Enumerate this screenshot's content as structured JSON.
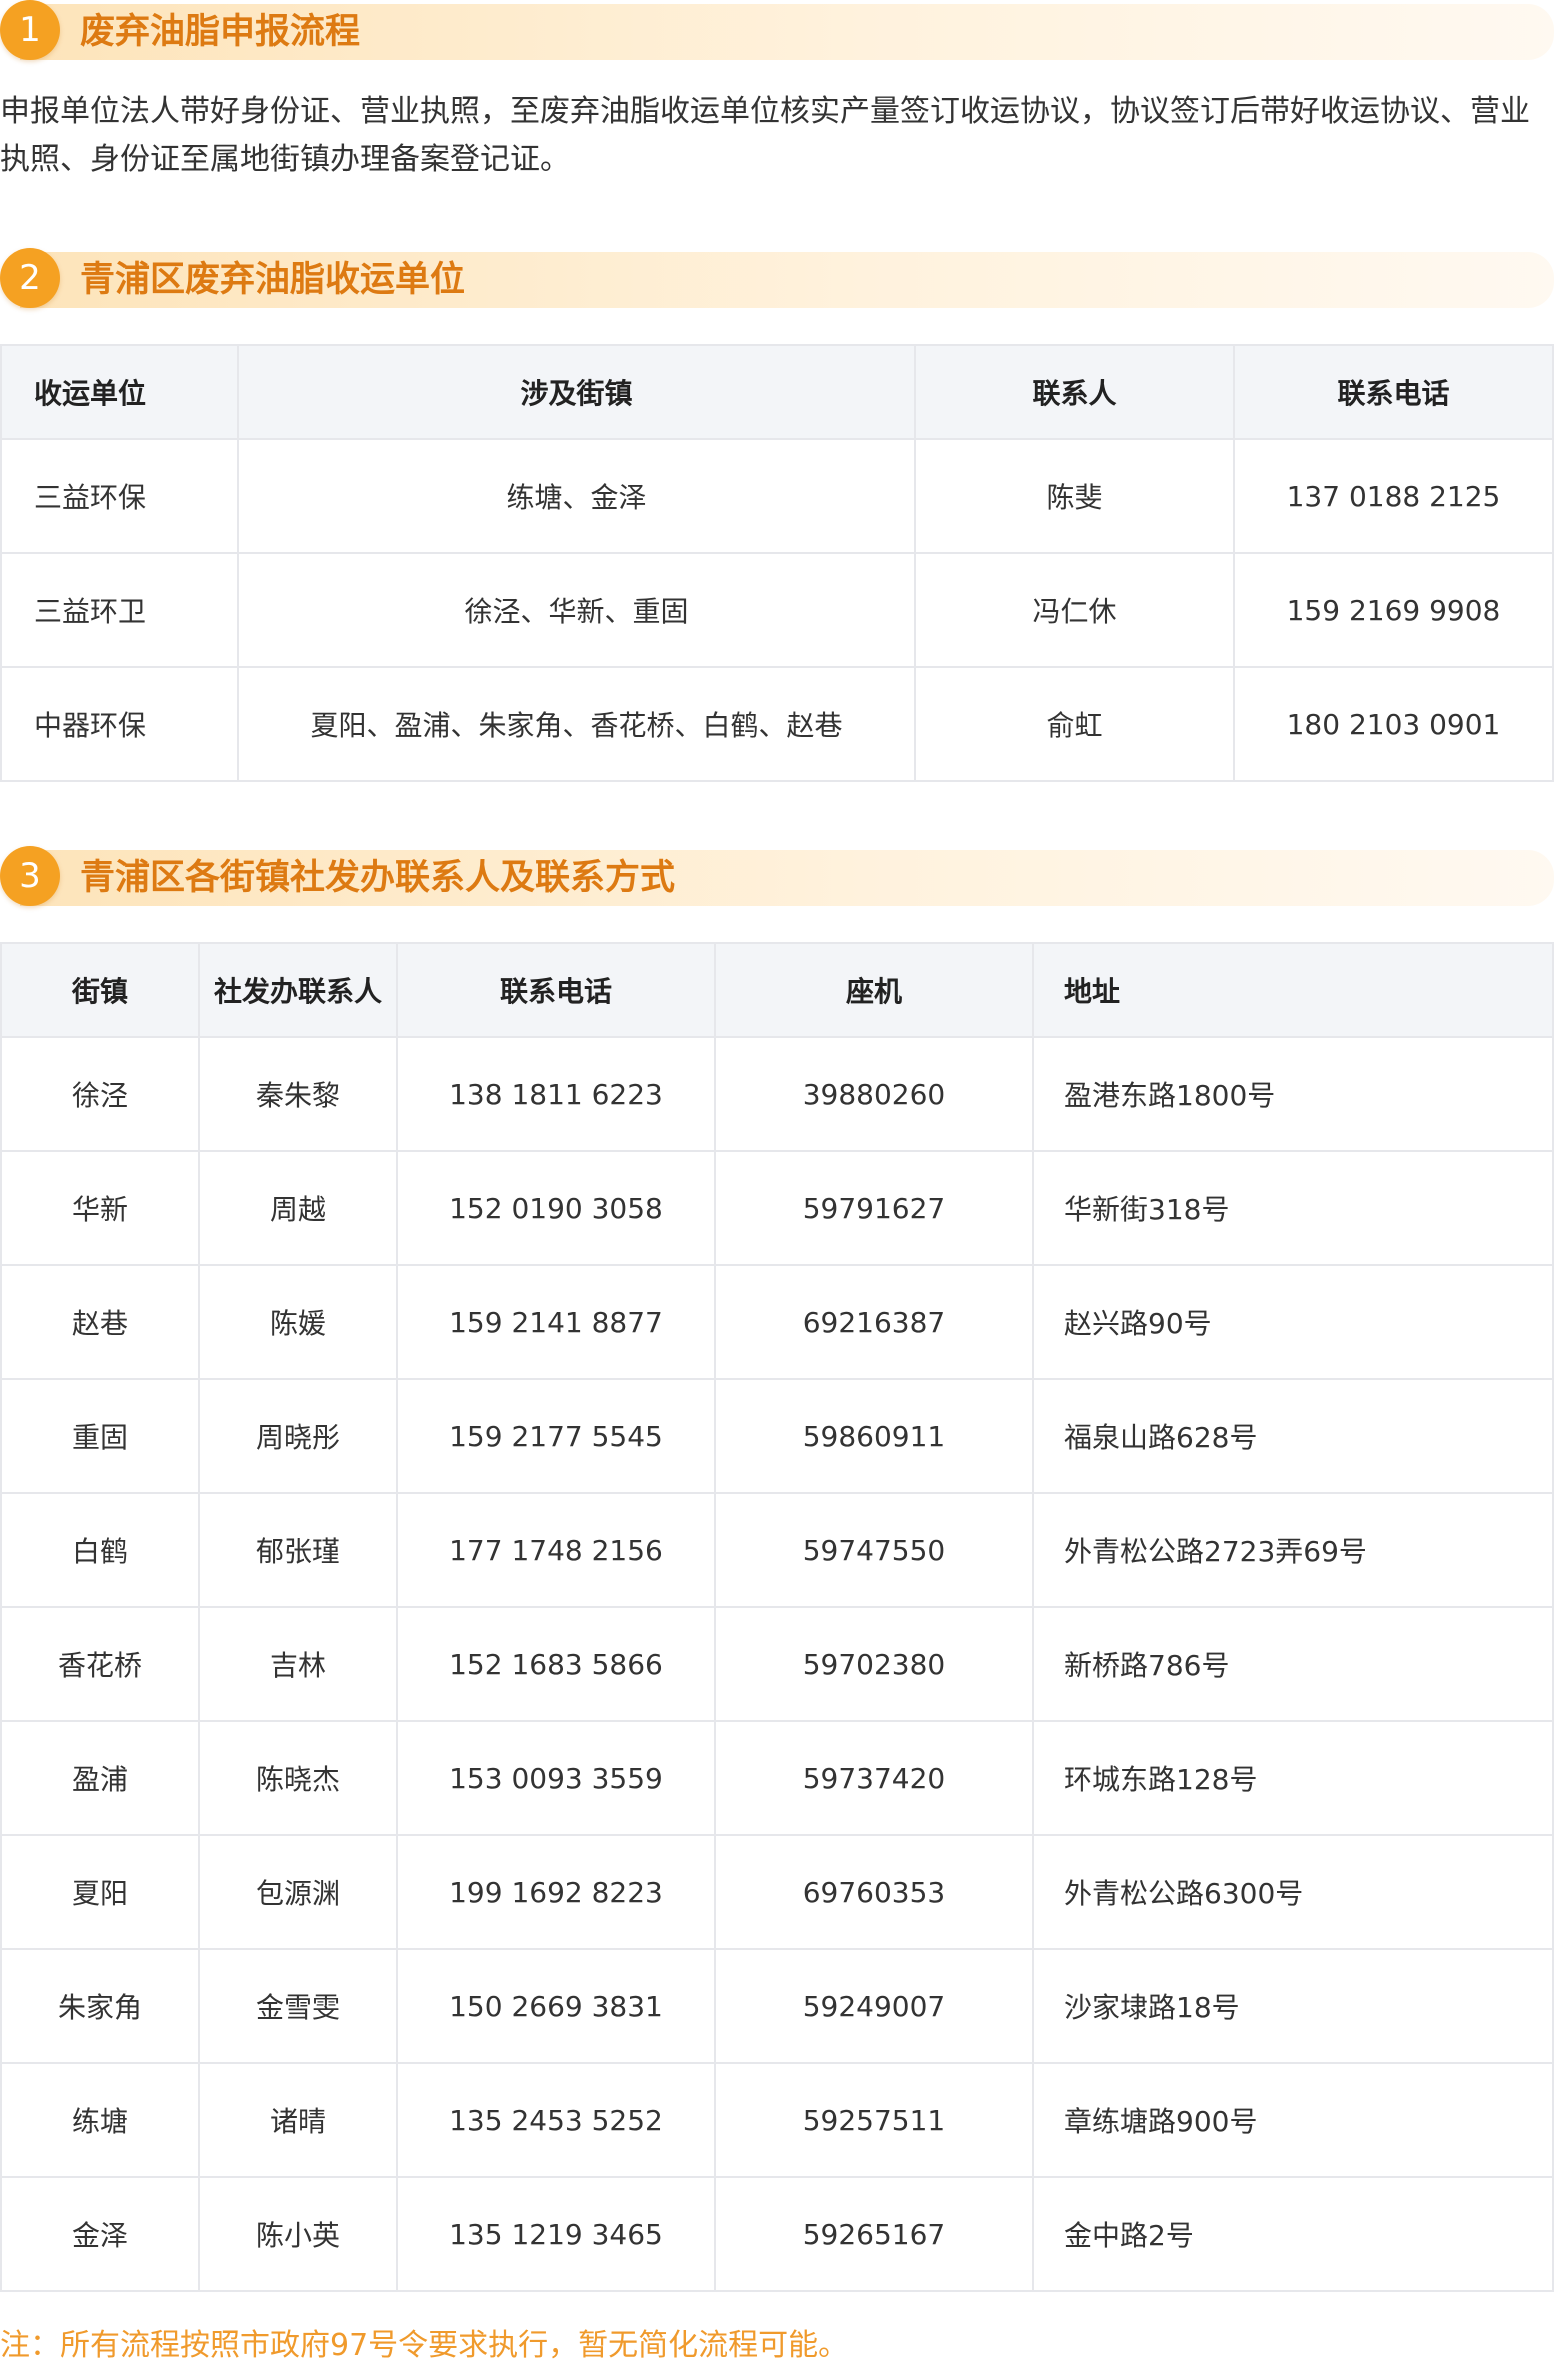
{
  "sections": [
    {
      "number": "1",
      "title": "废弃油脂申报流程"
    },
    {
      "number": "2",
      "title": "青浦区废弃油脂收运单位"
    },
    {
      "number": "3",
      "title": "青浦区各街镇社发办联系人及联系方式"
    }
  ],
  "process_text": "申报单位法人带好身份证、营业执照，至废弃油脂收运单位核实产量签订收运协议，协议签订后带好收运协议、营业执照、身份证至属地街镇办理备案登记证。",
  "units_table": {
    "headers": [
      "收运单位",
      "涉及街镇",
      "联系人",
      "联系电话"
    ],
    "rows": [
      [
        "三益环保",
        "练塘、金泽",
        "陈斐",
        "137 0188 2125"
      ],
      [
        "三益环卫",
        "徐泾、华新、重固",
        "冯仁休",
        "159 2169 9908"
      ],
      [
        "中器环保",
        "夏阳、盈浦、朱家角、香花桥、白鹤、赵巷",
        "俞虹",
        "180 2103 0901"
      ]
    ]
  },
  "contacts_table": {
    "headers": [
      "街镇",
      "社发办联系人",
      "联系电话",
      "座机",
      "地址"
    ],
    "rows": [
      [
        "徐泾",
        "秦朱黎",
        "138 1811 6223",
        "39880260",
        "盈港东路1800号"
      ],
      [
        "华新",
        "周越",
        "152 0190 3058",
        "59791627",
        "华新街318号"
      ],
      [
        "赵巷",
        "陈媛",
        "159 2141 8877",
        "69216387",
        "赵兴路90号"
      ],
      [
        "重固",
        "周晓彤",
        "159 2177 5545",
        "59860911",
        "福泉山路628号"
      ],
      [
        "白鹤",
        "郁张瑾",
        "177 1748 2156",
        "59747550",
        "外青松公路2723弄69号"
      ],
      [
        "香花桥",
        "吉林",
        "152 1683 5866",
        "59702380",
        "新桥路786号"
      ],
      [
        "盈浦",
        "陈晓杰",
        "153 0093 3559",
        "59737420",
        "环城东路128号"
      ],
      [
        "夏阳",
        "包源渊",
        "199 1692 8223",
        "69760353",
        "外青松公路6300号"
      ],
      [
        "朱家角",
        "金雪雯",
        "150 2669 3831",
        "59249007",
        "沙家埭路18号"
      ],
      [
        "练塘",
        "诸晴",
        "135 2453 5252",
        "59257511",
        "章练塘路900号"
      ],
      [
        "金泽",
        "陈小英",
        "135 1219 3465",
        "59265167",
        "金中路2号"
      ]
    ]
  },
  "note": "注：所有流程按照市政府97号令要求执行，暂无简化流程可能。"
}
